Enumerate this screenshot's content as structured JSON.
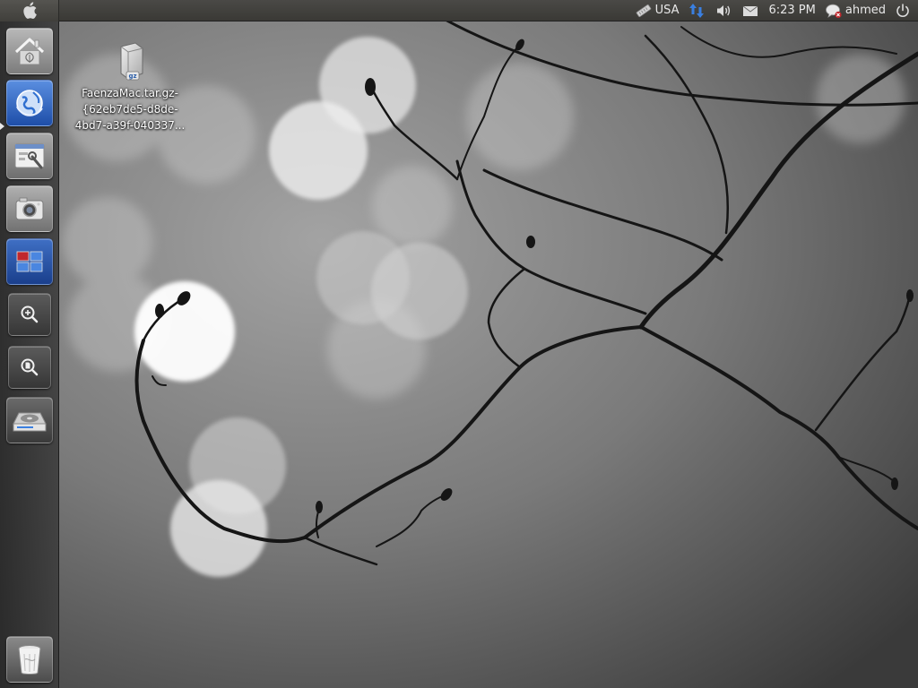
{
  "top_panel": {
    "keyboard_layout": "USA",
    "clock": "6:23 PM",
    "username": "ahmed",
    "icons": [
      "apple-logo-icon",
      "keyboard-icon",
      "network-icon",
      "volume-icon",
      "mail-icon",
      "chat-status-icon",
      "power-icon"
    ]
  },
  "launcher": {
    "items": [
      {
        "name": "home-folder",
        "icon": "home-icon"
      },
      {
        "name": "web-browser",
        "icon": "globe-icon"
      },
      {
        "name": "system-settings",
        "icon": "settings-icon"
      },
      {
        "name": "screenshot",
        "icon": "camera-icon"
      },
      {
        "name": "workspace-switcher",
        "icon": "workspaces-icon"
      },
      {
        "name": "zoom-in",
        "icon": "zoom-in-icon"
      },
      {
        "name": "file-search",
        "icon": "document-search-icon"
      },
      {
        "name": "disk-drive",
        "icon": "hard-drive-icon"
      },
      {
        "name": "trash",
        "icon": "trash-icon"
      }
    ]
  },
  "desktop": {
    "icons": [
      {
        "label_lines": [
          "FaenzaMac.tar.gz-",
          "{62eb7de5-d8de-",
          "4bd7-a39f-040337..."
        ],
        "icon": "archive-file-icon",
        "badge": "gz"
      }
    ]
  },
  "colors": {
    "panel": "#3e3d39",
    "launcher": "#333333",
    "accent_blue": "#2f6fd0",
    "accent_red": "#c0282d"
  }
}
